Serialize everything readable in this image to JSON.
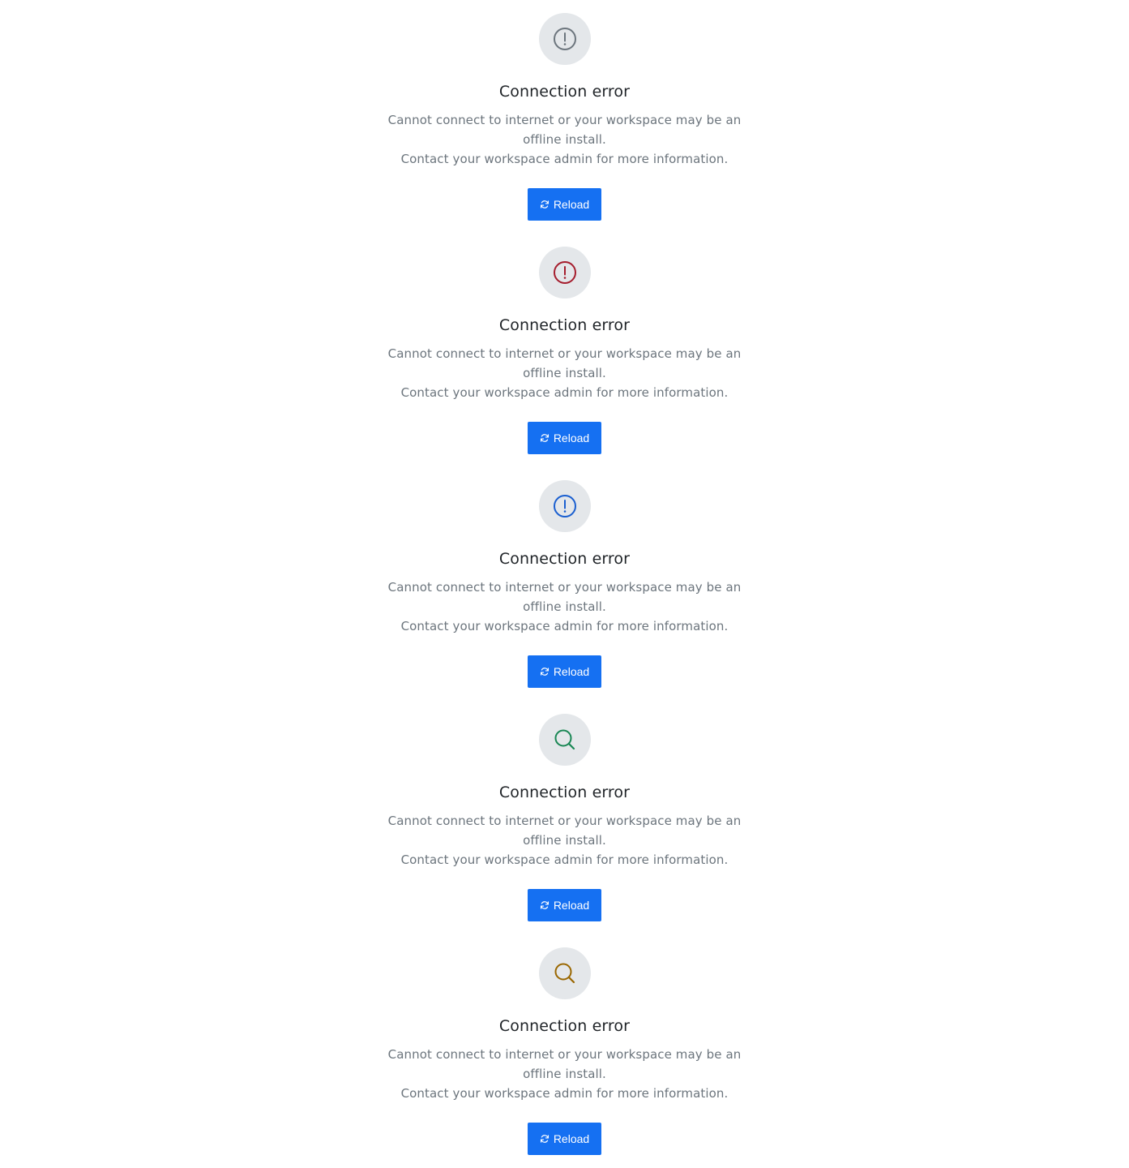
{
  "states": [
    {
      "icon": "alert-circle-icon",
      "icon_color": "#6c757d",
      "title": "Connection error",
      "line1": "Cannot connect to internet or your workspace may be an offline install.",
      "line2": "Contact your workspace admin for more information.",
      "button_label": "Reload",
      "button_icon": "refresh-icon"
    },
    {
      "icon": "alert-circle-icon",
      "icon_color": "#a51d2d",
      "title": "Connection error",
      "line1": "Cannot connect to internet or your workspace may be an offline install.",
      "line2": "Contact your workspace admin for more information.",
      "button_label": "Reload",
      "button_icon": "refresh-icon"
    },
    {
      "icon": "alert-circle-icon",
      "icon_color": "#1a5fd0",
      "title": "Connection error",
      "line1": "Cannot connect to internet or your workspace may be an offline install.",
      "line2": "Contact your workspace admin for more information.",
      "button_label": "Reload",
      "button_icon": "refresh-icon"
    },
    {
      "icon": "search-icon",
      "icon_color": "#198754",
      "title": "Connection error",
      "line1": "Cannot connect to internet or your workspace may be an offline install.",
      "line2": "Contact your workspace admin for more information.",
      "button_label": "Reload",
      "button_icon": "refresh-icon"
    },
    {
      "icon": "search-icon",
      "icon_color": "#9a6700",
      "title": "Connection error",
      "line1": "Cannot connect to internet or your workspace may be an offline install.",
      "line2": "Contact your workspace admin for more information.",
      "button_label": "Reload",
      "button_icon": "refresh-icon"
    }
  ],
  "colors": {
    "button_bg": "#1570f2",
    "icon_circle_bg": "#e4e7ea",
    "title": "#212529",
    "text_muted": "#6c757d"
  }
}
